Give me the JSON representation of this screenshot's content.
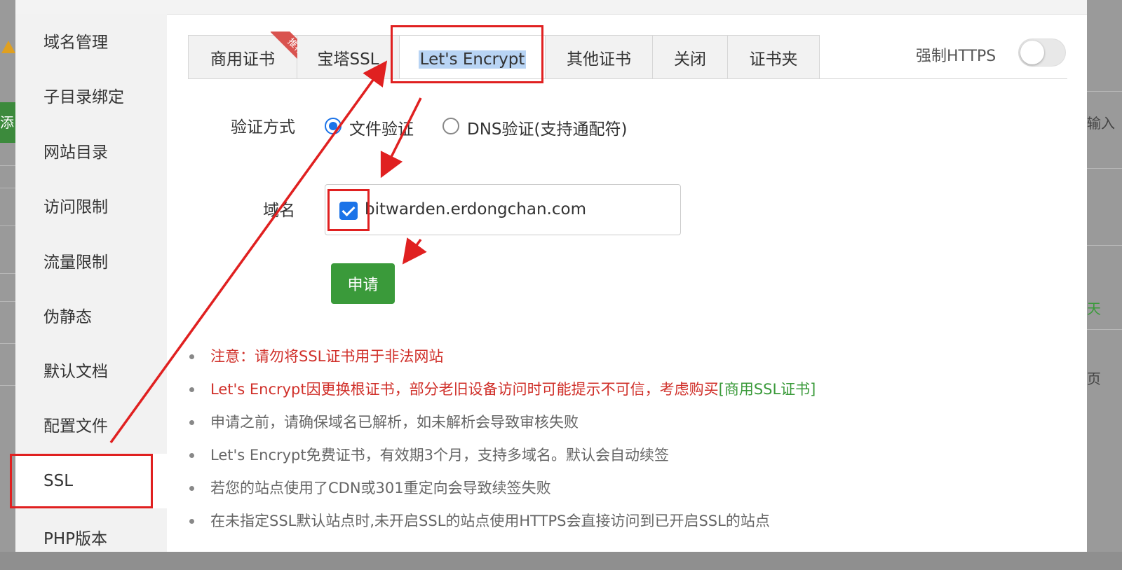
{
  "background": {
    "left_button": "添",
    "right_texts": [
      "输入",
      "天",
      "页"
    ]
  },
  "sidebar": {
    "items": [
      {
        "label": "域名管理"
      },
      {
        "label": "子目录绑定"
      },
      {
        "label": "网站目录"
      },
      {
        "label": "访问限制"
      },
      {
        "label": "流量限制"
      },
      {
        "label": "伪静态"
      },
      {
        "label": "默认文档"
      },
      {
        "label": "配置文件"
      },
      {
        "label": "SSL"
      },
      {
        "label": "PHP版本"
      }
    ],
    "active": "SSL"
  },
  "tabs": {
    "items": [
      {
        "label": "商用证书",
        "ribbon": "推荐"
      },
      {
        "label": "宝塔SSL"
      },
      {
        "label": "Let's Encrypt"
      },
      {
        "label": "其他证书"
      },
      {
        "label": "关闭"
      },
      {
        "label": "证书夹"
      }
    ],
    "active": "Let's Encrypt"
  },
  "force_https": {
    "label": "强制HTTPS",
    "enabled": false
  },
  "verification": {
    "label": "验证方式",
    "options": [
      "文件验证",
      "DNS验证(支持通配符)"
    ],
    "selected": "文件验证"
  },
  "domain": {
    "label": "域名",
    "items": [
      {
        "name": "bitwarden.erdongchan.com",
        "checked": true
      }
    ]
  },
  "apply_button": "申请",
  "notes": {
    "items": [
      {
        "text": "注意：请勿将SSL证书用于非法网站",
        "style": "red"
      },
      {
        "text": "Let's Encrypt因更换根证书，部分老旧设备访问时可能提示不可信，考虑购买",
        "link": "[商用SSL证书]",
        "style": "red"
      },
      {
        "text": "申请之前，请确保域名已解析，如未解析会导致审核失败"
      },
      {
        "text": "Let's Encrypt免费证书，有效期3个月，支持多域名。默认会自动续签"
      },
      {
        "text": "若您的站点使用了CDN或301重定向会导致续签失败"
      },
      {
        "text": "在未指定SSL默认站点时,未开启SSL的站点使用HTTPS会直接访问到已开启SSL的站点"
      }
    ]
  },
  "colors": {
    "annotation": "#e02020",
    "primary": "#1b73e8",
    "success": "#3a9a3a",
    "danger_text": "#d0302a"
  }
}
